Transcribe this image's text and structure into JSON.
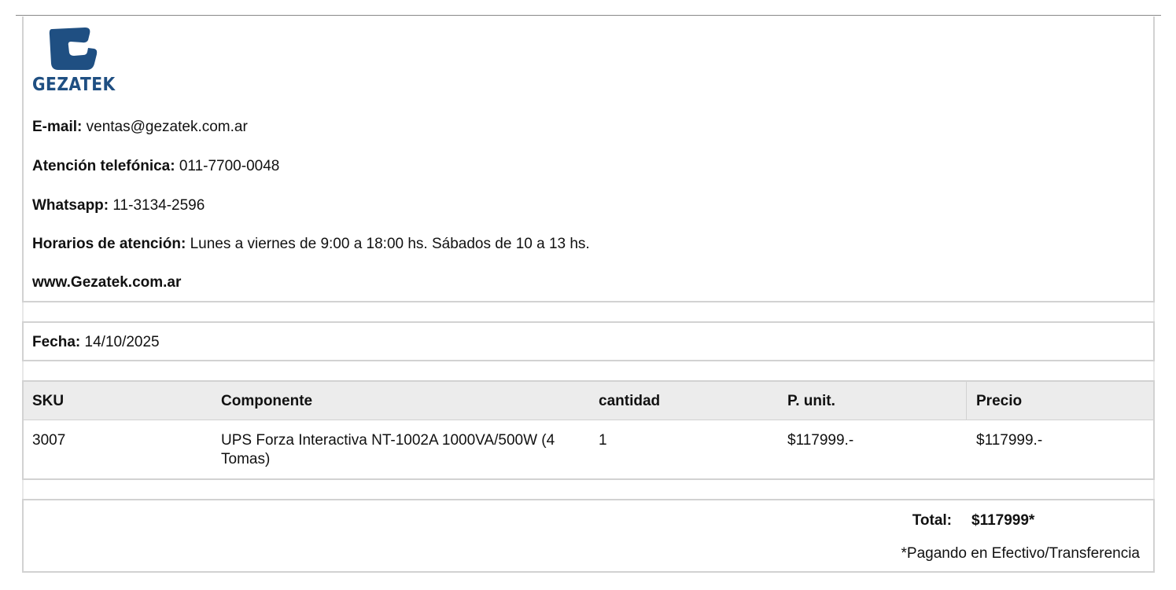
{
  "company": {
    "logo_text": "GEZATEK",
    "brand_color": "#1f4f82",
    "logo_icon": "gezatek-logo-icon"
  },
  "contact": {
    "email_label": "E-mail:",
    "email_value": " ventas@gezatek.com.ar",
    "phone_label": "Atención telefónica:",
    "phone_value": " 011-7700-0048",
    "whatsapp_label": "Whatsapp:",
    "whatsapp_value": " 11-3134-2596",
    "hours_label": "Horarios de atención:",
    "hours_value": " Lunes a viernes de 9:00 a 18:00 hs. Sábados de 10 a 13 hs.",
    "website": "www.Gezatek.com.ar"
  },
  "date": {
    "label": "Fecha:",
    "value": " 14/10/2025"
  },
  "table": {
    "headers": [
      "SKU",
      "Componente",
      "cantidad",
      "P. unit.",
      "Precio"
    ],
    "rows": [
      [
        "3007",
        "UPS Forza Interactiva NT-1002A 1000VA/500W (4 Tomas)",
        "1",
        "$117999.-",
        "$117999.-"
      ]
    ]
  },
  "totals": {
    "label": "Total:",
    "value": "$117999*",
    "note": "*Pagando en Efectivo/Transferencia"
  },
  "colors": {
    "border": "#d2d2d2",
    "header_bg": "#ececec"
  }
}
